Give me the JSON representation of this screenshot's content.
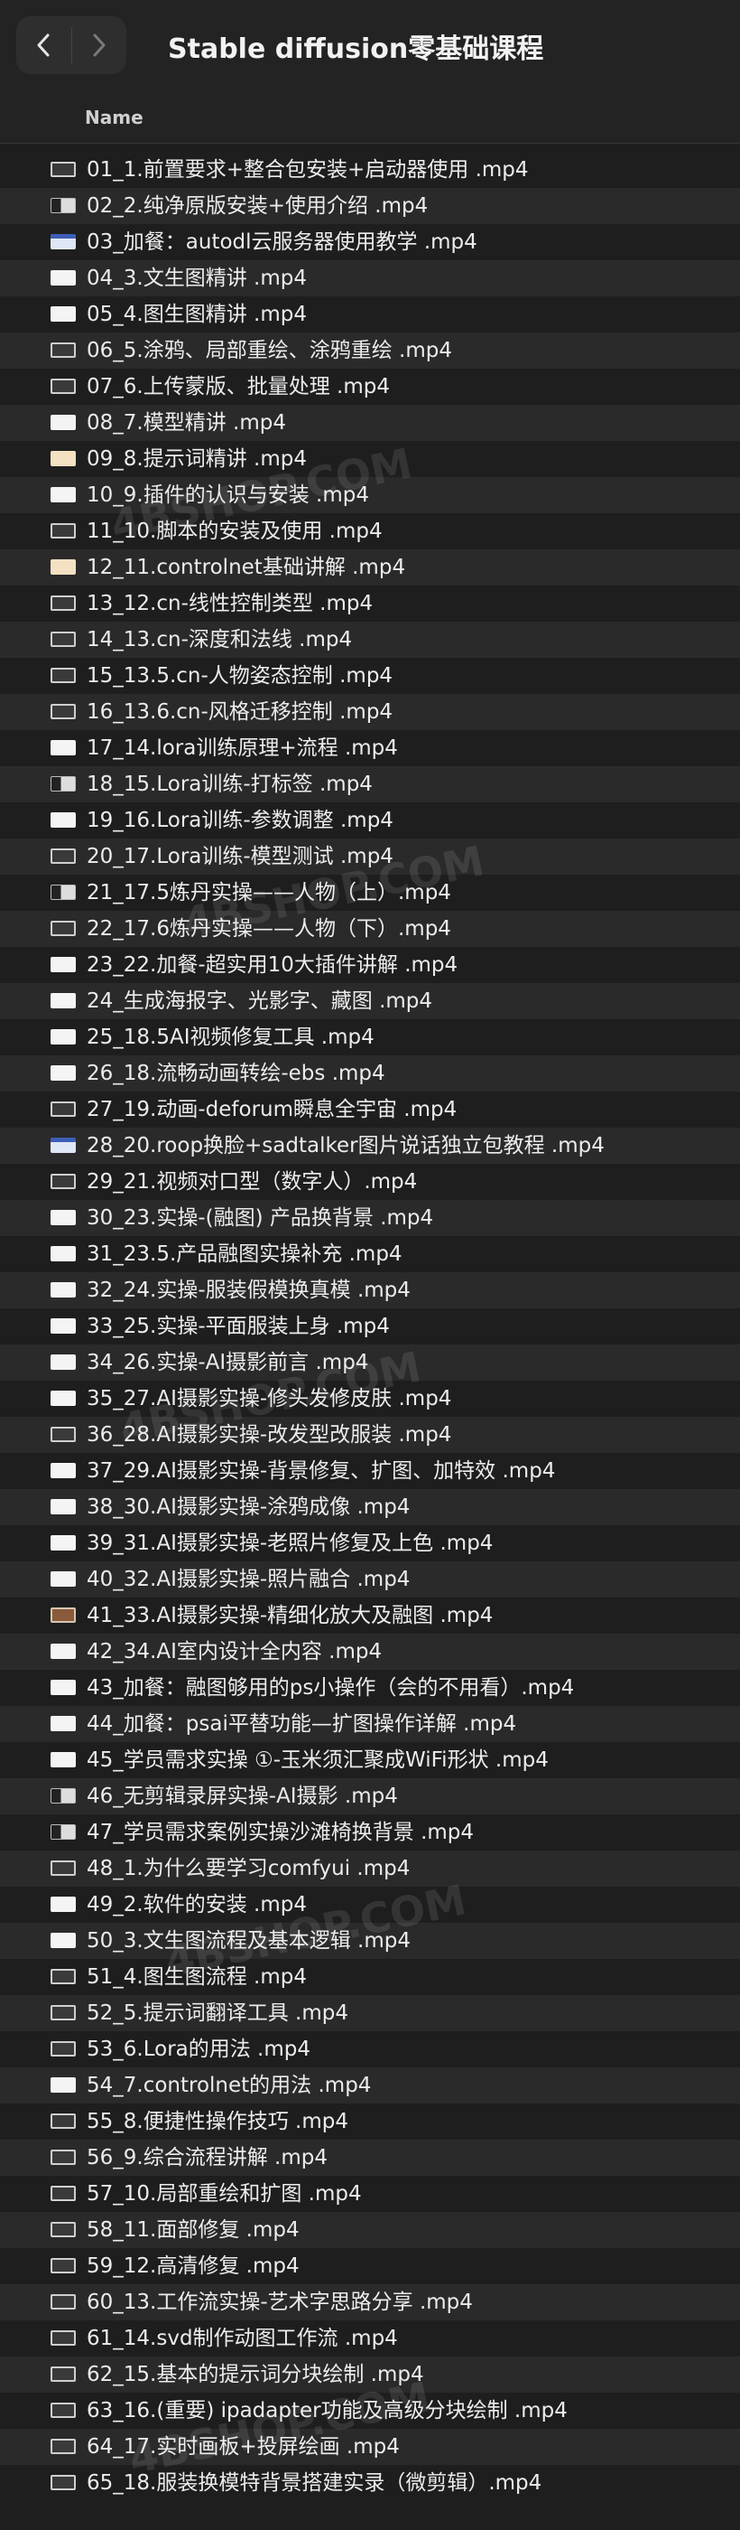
{
  "window": {
    "title": "Stable diffusion零基础课程",
    "back_icon": "chevron-left-icon",
    "forward_icon": "chevron-right-icon"
  },
  "columns": {
    "name": "Name"
  },
  "watermark": "4BSHOP.COM",
  "files": [
    {
      "name": "01_1.前置要求+整合包安装+启动器使用 .mp4",
      "thumb": "dark"
    },
    {
      "name": "02_2.纯净原版安装+使用介绍 .mp4",
      "thumb": "mix"
    },
    {
      "name": "03_加餐：autodl云服务器使用教学 .mp4",
      "thumb": "blue"
    },
    {
      "name": "04_3.文生图精讲 .mp4",
      "thumb": "light"
    },
    {
      "name": "05_4.图生图精讲 .mp4",
      "thumb": "light"
    },
    {
      "name": "06_5.涂鸦、局部重绘、涂鸦重绘 .mp4",
      "thumb": "dark"
    },
    {
      "name": "07_6.上传蒙版、批量处理 .mp4",
      "thumb": "dark"
    },
    {
      "name": "08_7.模型精讲 .mp4",
      "thumb": "light"
    },
    {
      "name": "09_8.提示词精讲 .mp4",
      "thumb": "warm"
    },
    {
      "name": "10_9.插件的认识与安装 .mp4",
      "thumb": "light"
    },
    {
      "name": "11_10.脚本的安装及使用 .mp4",
      "thumb": "dark"
    },
    {
      "name": "12_11.controlnet基础讲解 .mp4",
      "thumb": "warm"
    },
    {
      "name": "13_12.cn-线性控制类型 .mp4",
      "thumb": "dark"
    },
    {
      "name": "14_13.cn-深度和法线 .mp4",
      "thumb": "dark"
    },
    {
      "name": "15_13.5.cn-人物姿态控制 .mp4",
      "thumb": "dark"
    },
    {
      "name": "16_13.6.cn-风格迁移控制 .mp4",
      "thumb": "dark"
    },
    {
      "name": "17_14.lora训练原理+流程 .mp4",
      "thumb": "light"
    },
    {
      "name": "18_15.Lora训练-打标签 .mp4",
      "thumb": "mix"
    },
    {
      "name": "19_16.Lora训练-参数调整 .mp4",
      "thumb": "light"
    },
    {
      "name": "20_17.Lora训练-模型测试 .mp4",
      "thumb": "dark"
    },
    {
      "name": "21_17.5炼丹实操——人物（上）.mp4",
      "thumb": "mix"
    },
    {
      "name": "22_17.6炼丹实操——人物（下）.mp4",
      "thumb": "dark"
    },
    {
      "name": "23_22.加餐-超实用10大插件讲解 .mp4",
      "thumb": "light"
    },
    {
      "name": "24_生成海报字、光影字、藏图 .mp4",
      "thumb": "light"
    },
    {
      "name": "25_18.5AI视频修复工具 .mp4",
      "thumb": "light"
    },
    {
      "name": "26_18.流畅动画转绘-ebs .mp4",
      "thumb": "light"
    },
    {
      "name": "27_19.动画-deforum瞬息全宇宙 .mp4",
      "thumb": "dark"
    },
    {
      "name": "28_20.roop换脸+sadtalker图片说话独立包教程 .mp4",
      "thumb": "blue"
    },
    {
      "name": "29_21.视频对口型（数字人）.mp4",
      "thumb": "dark"
    },
    {
      "name": "30_23.实操-(融图) 产品换背景 .mp4",
      "thumb": "light"
    },
    {
      "name": "31_23.5.产品融图实操补充 .mp4",
      "thumb": "light"
    },
    {
      "name": "32_24.实操-服装假模换真模 .mp4",
      "thumb": "light"
    },
    {
      "name": "33_25.实操-平面服装上身 .mp4",
      "thumb": "light"
    },
    {
      "name": "34_26.实操-AI摄影前言 .mp4",
      "thumb": "light"
    },
    {
      "name": "35_27.AI摄影实操-修头发修皮肤 .mp4",
      "thumb": "light"
    },
    {
      "name": "36_28.AI摄影实操-改发型改服装 .mp4",
      "thumb": "dark"
    },
    {
      "name": "37_29.AI摄影实操-背景修复、扩图、加特效 .mp4",
      "thumb": "light"
    },
    {
      "name": "38_30.AI摄影实操-涂鸦成像 .mp4",
      "thumb": "light"
    },
    {
      "name": "39_31.AI摄影实操-老照片修复及上色 .mp4",
      "thumb": "light"
    },
    {
      "name": "40_32.AI摄影实操-照片融合 .mp4",
      "thumb": "light"
    },
    {
      "name": "41_33.AI摄影实操-精细化放大及融图 .mp4",
      "thumb": "orange"
    },
    {
      "name": "42_34.AI室内设计全内容 .mp4",
      "thumb": "light"
    },
    {
      "name": "43_加餐：融图够用的ps小操作（会的不用看）.mp4",
      "thumb": "light"
    },
    {
      "name": "44_加餐：psai平替功能—扩图操作详解 .mp4",
      "thumb": "light"
    },
    {
      "name": "45_学员需求实操 ①-玉米须汇聚成WiFi形状 .mp4",
      "thumb": "light"
    },
    {
      "name": "46_无剪辑录屏实操-AI摄影 .mp4",
      "thumb": "mix"
    },
    {
      "name": "47_学员需求案例实操沙滩椅换背景 .mp4",
      "thumb": "mix"
    },
    {
      "name": "48_1.为什么要学习comfyui .mp4",
      "thumb": "dark"
    },
    {
      "name": "49_2.软件的安装 .mp4",
      "thumb": "light"
    },
    {
      "name": "50_3.文生图流程及基本逻辑 .mp4",
      "thumb": "light"
    },
    {
      "name": "51_4.图生图流程 .mp4",
      "thumb": "dark"
    },
    {
      "name": "52_5.提示词翻译工具 .mp4",
      "thumb": "dark"
    },
    {
      "name": "53_6.Lora的用法 .mp4",
      "thumb": "dark"
    },
    {
      "name": "54_7.controlnet的用法 .mp4",
      "thumb": "light"
    },
    {
      "name": "55_8.便捷性操作技巧 .mp4",
      "thumb": "dark"
    },
    {
      "name": "56_9.综合流程讲解 .mp4",
      "thumb": "dark"
    },
    {
      "name": "57_10.局部重绘和扩图 .mp4",
      "thumb": "dark"
    },
    {
      "name": "58_11.面部修复 .mp4",
      "thumb": "dark"
    },
    {
      "name": "59_12.高清修复 .mp4",
      "thumb": "dark"
    },
    {
      "name": "60_13.工作流实操-艺术字思路分享 .mp4",
      "thumb": "dark"
    },
    {
      "name": "61_14.svd制作动图工作流 .mp4",
      "thumb": "dark"
    },
    {
      "name": "62_15.基本的提示词分块绘制 .mp4",
      "thumb": "dark"
    },
    {
      "name": "63_16.(重要) ipadapter功能及高级分块绘制 .mp4",
      "thumb": "dark"
    },
    {
      "name": "64_17.实时画板+投屏绘画 .mp4",
      "thumb": "dark"
    },
    {
      "name": "65_18.服装换模特背景搭建实录（微剪辑）.mp4",
      "thumb": "dark"
    }
  ]
}
